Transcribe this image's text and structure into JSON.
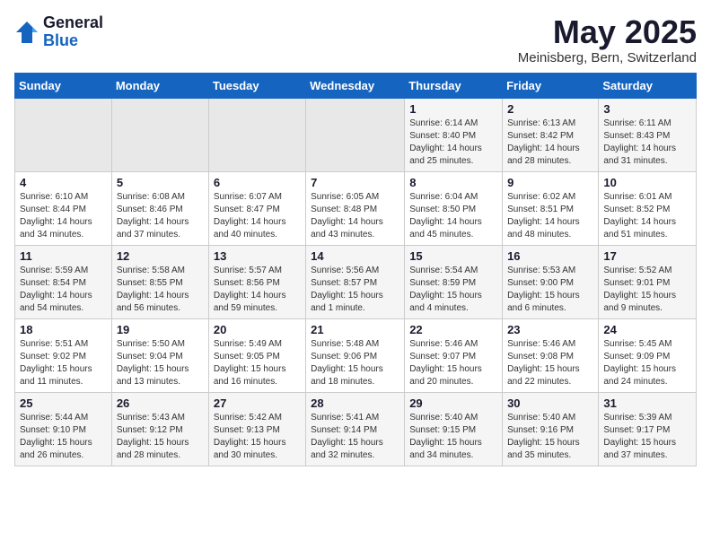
{
  "header": {
    "logo_general": "General",
    "logo_blue": "Blue",
    "month_title": "May 2025",
    "location": "Meinisberg, Bern, Switzerland"
  },
  "days_of_week": [
    "Sunday",
    "Monday",
    "Tuesday",
    "Wednesday",
    "Thursday",
    "Friday",
    "Saturday"
  ],
  "weeks": [
    [
      {
        "day": "",
        "empty": true
      },
      {
        "day": "",
        "empty": true
      },
      {
        "day": "",
        "empty": true
      },
      {
        "day": "",
        "empty": true
      },
      {
        "day": "1",
        "sunrise": "6:14 AM",
        "sunset": "8:40 PM",
        "daylight": "14 hours and 25 minutes."
      },
      {
        "day": "2",
        "sunrise": "6:13 AM",
        "sunset": "8:42 PM",
        "daylight": "14 hours and 28 minutes."
      },
      {
        "day": "3",
        "sunrise": "6:11 AM",
        "sunset": "8:43 PM",
        "daylight": "14 hours and 31 minutes."
      }
    ],
    [
      {
        "day": "4",
        "sunrise": "6:10 AM",
        "sunset": "8:44 PM",
        "daylight": "14 hours and 34 minutes."
      },
      {
        "day": "5",
        "sunrise": "6:08 AM",
        "sunset": "8:46 PM",
        "daylight": "14 hours and 37 minutes."
      },
      {
        "day": "6",
        "sunrise": "6:07 AM",
        "sunset": "8:47 PM",
        "daylight": "14 hours and 40 minutes."
      },
      {
        "day": "7",
        "sunrise": "6:05 AM",
        "sunset": "8:48 PM",
        "daylight": "14 hours and 43 minutes."
      },
      {
        "day": "8",
        "sunrise": "6:04 AM",
        "sunset": "8:50 PM",
        "daylight": "14 hours and 45 minutes."
      },
      {
        "day": "9",
        "sunrise": "6:02 AM",
        "sunset": "8:51 PM",
        "daylight": "14 hours and 48 minutes."
      },
      {
        "day": "10",
        "sunrise": "6:01 AM",
        "sunset": "8:52 PM",
        "daylight": "14 hours and 51 minutes."
      }
    ],
    [
      {
        "day": "11",
        "sunrise": "5:59 AM",
        "sunset": "8:54 PM",
        "daylight": "14 hours and 54 minutes."
      },
      {
        "day": "12",
        "sunrise": "5:58 AM",
        "sunset": "8:55 PM",
        "daylight": "14 hours and 56 minutes."
      },
      {
        "day": "13",
        "sunrise": "5:57 AM",
        "sunset": "8:56 PM",
        "daylight": "14 hours and 59 minutes."
      },
      {
        "day": "14",
        "sunrise": "5:56 AM",
        "sunset": "8:57 PM",
        "daylight": "15 hours and 1 minute."
      },
      {
        "day": "15",
        "sunrise": "5:54 AM",
        "sunset": "8:59 PM",
        "daylight": "15 hours and 4 minutes."
      },
      {
        "day": "16",
        "sunrise": "5:53 AM",
        "sunset": "9:00 PM",
        "daylight": "15 hours and 6 minutes."
      },
      {
        "day": "17",
        "sunrise": "5:52 AM",
        "sunset": "9:01 PM",
        "daylight": "15 hours and 9 minutes."
      }
    ],
    [
      {
        "day": "18",
        "sunrise": "5:51 AM",
        "sunset": "9:02 PM",
        "daylight": "15 hours and 11 minutes."
      },
      {
        "day": "19",
        "sunrise": "5:50 AM",
        "sunset": "9:04 PM",
        "daylight": "15 hours and 13 minutes."
      },
      {
        "day": "20",
        "sunrise": "5:49 AM",
        "sunset": "9:05 PM",
        "daylight": "15 hours and 16 minutes."
      },
      {
        "day": "21",
        "sunrise": "5:48 AM",
        "sunset": "9:06 PM",
        "daylight": "15 hours and 18 minutes."
      },
      {
        "day": "22",
        "sunrise": "5:46 AM",
        "sunset": "9:07 PM",
        "daylight": "15 hours and 20 minutes."
      },
      {
        "day": "23",
        "sunrise": "5:46 AM",
        "sunset": "9:08 PM",
        "daylight": "15 hours and 22 minutes."
      },
      {
        "day": "24",
        "sunrise": "5:45 AM",
        "sunset": "9:09 PM",
        "daylight": "15 hours and 24 minutes."
      }
    ],
    [
      {
        "day": "25",
        "sunrise": "5:44 AM",
        "sunset": "9:10 PM",
        "daylight": "15 hours and 26 minutes."
      },
      {
        "day": "26",
        "sunrise": "5:43 AM",
        "sunset": "9:12 PM",
        "daylight": "15 hours and 28 minutes."
      },
      {
        "day": "27",
        "sunrise": "5:42 AM",
        "sunset": "9:13 PM",
        "daylight": "15 hours and 30 minutes."
      },
      {
        "day": "28",
        "sunrise": "5:41 AM",
        "sunset": "9:14 PM",
        "daylight": "15 hours and 32 minutes."
      },
      {
        "day": "29",
        "sunrise": "5:40 AM",
        "sunset": "9:15 PM",
        "daylight": "15 hours and 34 minutes."
      },
      {
        "day": "30",
        "sunrise": "5:40 AM",
        "sunset": "9:16 PM",
        "daylight": "15 hours and 35 minutes."
      },
      {
        "day": "31",
        "sunrise": "5:39 AM",
        "sunset": "9:17 PM",
        "daylight": "15 hours and 37 minutes."
      }
    ]
  ],
  "labels": {
    "sunrise": "Sunrise: ",
    "sunset": "Sunset: ",
    "daylight": "Daylight: "
  }
}
